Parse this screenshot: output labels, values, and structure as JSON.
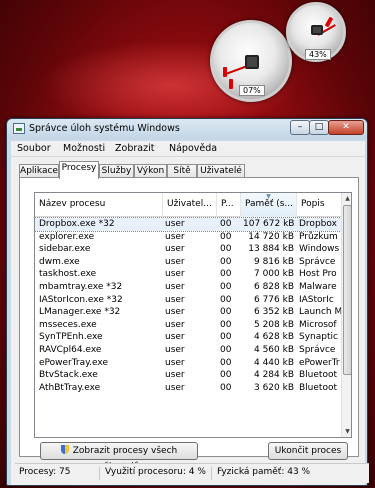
{
  "gadget": {
    "cpu_percent": "07%",
    "mem_percent": "43%"
  },
  "window": {
    "title": "Správce úloh systému Windows"
  },
  "menu": [
    "Soubor",
    "Možnosti",
    "Zobrazit",
    "Nápověda"
  ],
  "tabs": [
    "Aplikace",
    "Procesy",
    "Služby",
    "Výkon",
    "Sítě",
    "Uživatelé"
  ],
  "active_tab": "Procesy",
  "table": {
    "headers": [
      "Název procesu",
      "Uživatel...",
      "P...",
      "Paměť (s...",
      "Popis"
    ],
    "rows": [
      [
        "Dropbox.exe *32",
        "user",
        "00",
        "107 672 kB",
        "Dropbox"
      ],
      [
        "explorer.exe",
        "user",
        "00",
        "14 720 kB",
        "Průzkum"
      ],
      [
        "sidebar.exe",
        "user",
        "00",
        "13 884 kB",
        "Windows"
      ],
      [
        "dwm.exe",
        "user",
        "00",
        "9 816 kB",
        "Správce"
      ],
      [
        "taskhost.exe",
        "user",
        "00",
        "7 000 kB",
        "Host Pro"
      ],
      [
        "mbamtray.exe *32",
        "user",
        "00",
        "6 828 kB",
        "Malware"
      ],
      [
        "IAStorIcon.exe *32",
        "user",
        "00",
        "6 776 kB",
        "IAStorIc"
      ],
      [
        "LManager.exe *32",
        "user",
        "00",
        "6 352 kB",
        "Launch M"
      ],
      [
        "msseces.exe",
        "user",
        "00",
        "5 208 kB",
        "Microsof"
      ],
      [
        "SynTPEnh.exe",
        "user",
        "00",
        "4 628 kB",
        "Synaptic"
      ],
      [
        "RAVCpl64.exe",
        "user",
        "00",
        "4 560 kB",
        "Správce"
      ],
      [
        "ePowerTray.exe",
        "user",
        "00",
        "4 440 kB",
        "ePowerTr"
      ],
      [
        "BtvStack.exe",
        "user",
        "00",
        "4 284 kB",
        "Bluetoot"
      ],
      [
        "AthBtTray.exe",
        "user",
        "00",
        "3 620 kB",
        "Bluetoot"
      ]
    ]
  },
  "buttons": {
    "show_all": "Zobrazit procesy všech uživatelů",
    "end_process": "Ukončit proces"
  },
  "status": {
    "processes": "Procesy: 75",
    "cpu": "Využití procesoru: 4 %",
    "memory": "Fyzická paměť: 43 %"
  }
}
